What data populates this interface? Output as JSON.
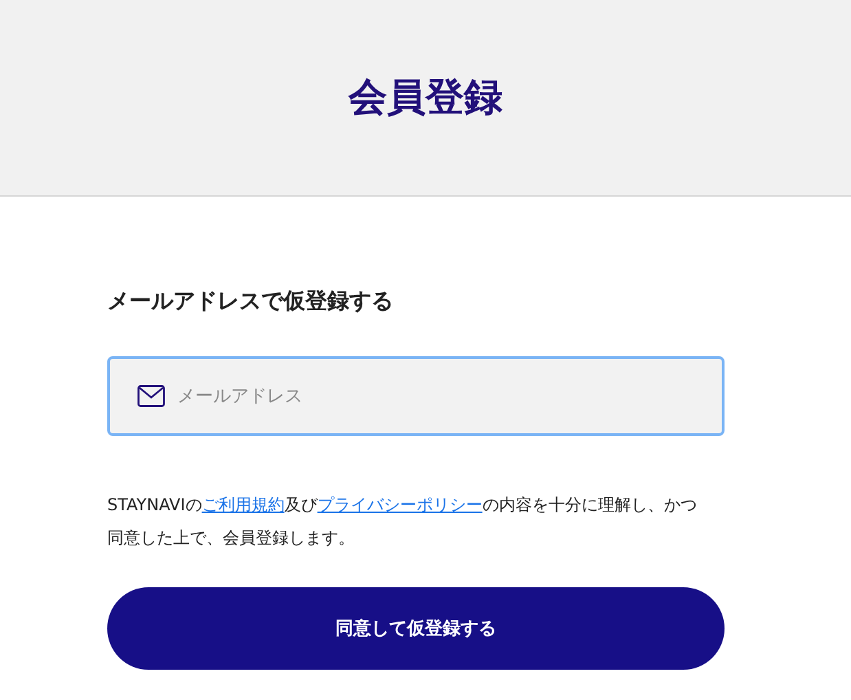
{
  "header": {
    "title": "会員登録"
  },
  "section_title": "メールアドレスで仮登録する",
  "email_field": {
    "placeholder": "メールアドレス"
  },
  "agreement": [
    {
      "kind": "text",
      "text": "STAYNAVIの"
    },
    {
      "kind": "link",
      "text": "ご利用規約"
    },
    {
      "kind": "text",
      "text": "及び"
    },
    {
      "kind": "link",
      "text": "プライバシーポリシー"
    },
    {
      "kind": "text",
      "text": "の内容を十分に理解し、かつ同意した上で、会員登録します。"
    }
  ],
  "submit_button": "同意して仮登録する"
}
